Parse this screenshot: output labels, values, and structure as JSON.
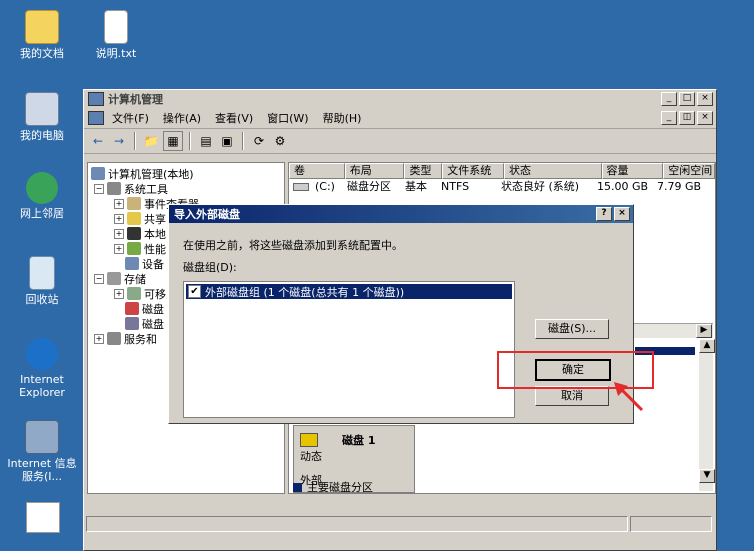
{
  "desktop": {
    "icons": [
      {
        "label": "我的文档",
        "name": "my-documents"
      },
      {
        "label": "说明.txt",
        "name": "readme-txt"
      },
      {
        "label": "我的电脑",
        "name": "my-computer"
      },
      {
        "label": "网上邻居",
        "name": "network-places"
      },
      {
        "label": "回收站",
        "name": "recycle-bin"
      },
      {
        "label": "Internet Explorer",
        "name": "internet-explorer"
      },
      {
        "label": "Internet 信息服务(I...",
        "name": "iis"
      }
    ]
  },
  "window": {
    "title": "计算机管理",
    "menu": [
      "文件(F)",
      "操作(A)",
      "查看(V)",
      "窗口(W)",
      "帮助(H)"
    ]
  },
  "tree": {
    "root": "计算机管理(本地)",
    "system_tools": "系统工具",
    "event_viewer": "事件查看器",
    "shared": "共享",
    "local": "本地",
    "perf": "性能",
    "devices": "设备",
    "storage": "存储",
    "removable": "可移",
    "disk1": "磁盘",
    "disk2": "磁盘",
    "services": "服务和"
  },
  "volume_table": {
    "headers": [
      "卷",
      "布局",
      "类型",
      "文件系统",
      "状态",
      "容量",
      "空闲空间"
    ],
    "rows": [
      [
        "(C:)",
        "磁盘分区",
        "基本",
        "NTFS",
        "状态良好 (系统)",
        "15.00 GB",
        "7.79 GB"
      ]
    ]
  },
  "disk_panel": {
    "disk_label": "磁盘 1",
    "dynamic": "动态",
    "external": "外部",
    "legend": "主要磁盘分区"
  },
  "dialog": {
    "title": "导入外部磁盘",
    "help": "?",
    "close": "×",
    "description": "在使用之前，将这些磁盘添加到系统配置中。",
    "group_label": "磁盘组(D):",
    "list_item": "外部磁盘组 (1 个磁盘(总共有 1 个磁盘))",
    "disk_button": "磁盘(S)...",
    "ok_button": "确定",
    "cancel_button": "取消"
  },
  "colors": {
    "desktop": "#2f6aa8",
    "dialog_title": "#0a246a",
    "highlight": "#e32b2b"
  }
}
